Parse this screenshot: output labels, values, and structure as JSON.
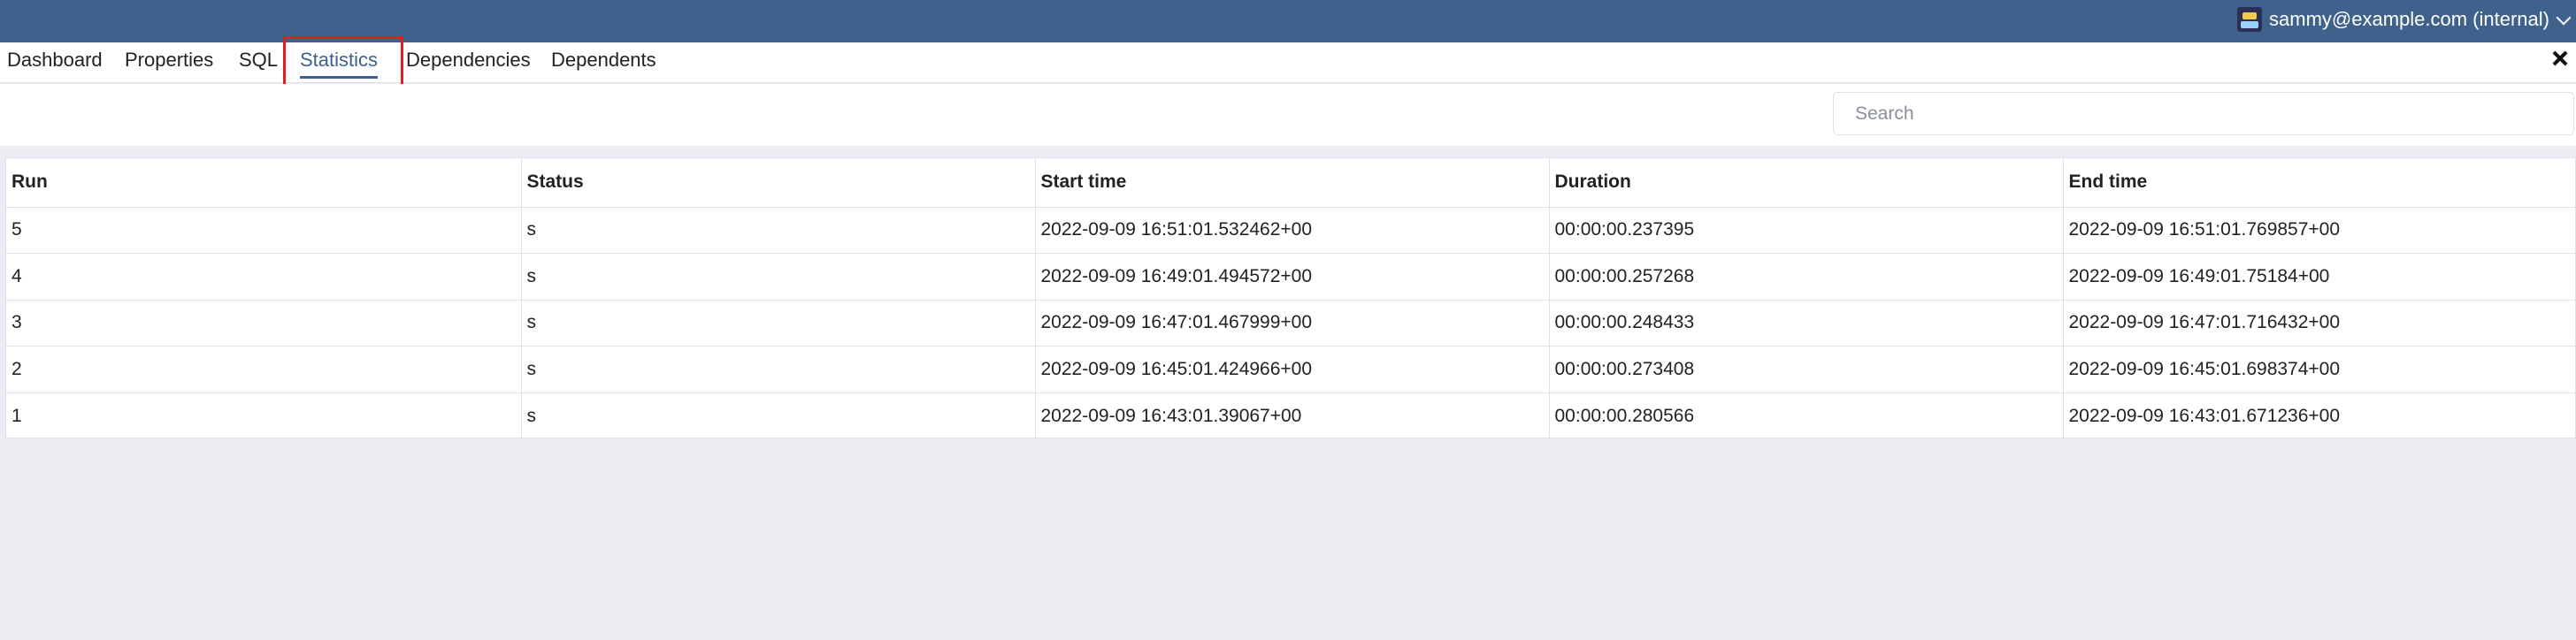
{
  "header": {
    "user_label": "sammy@example.com (internal)"
  },
  "tabs": [
    {
      "label": "Dashboard"
    },
    {
      "label": "Properties"
    },
    {
      "label": "SQL"
    },
    {
      "label": "Statistics"
    },
    {
      "label": "Dependencies"
    },
    {
      "label": "Dependents"
    }
  ],
  "search": {
    "placeholder": "Search",
    "value": ""
  },
  "table": {
    "columns": [
      "Run",
      "Status",
      "Start time",
      "Duration",
      "End time"
    ],
    "rows": [
      [
        "5",
        "s",
        "2022-09-09 16:51:01.532462+00",
        "00:00:00.237395",
        "2022-09-09 16:51:01.769857+00"
      ],
      [
        "4",
        "s",
        "2022-09-09 16:49:01.494572+00",
        "00:00:00.257268",
        "2022-09-09 16:49:01.75184+00"
      ],
      [
        "3",
        "s",
        "2022-09-09 16:47:01.467999+00",
        "00:00:00.248433",
        "2022-09-09 16:47:01.716432+00"
      ],
      [
        "2",
        "s",
        "2022-09-09 16:45:01.424966+00",
        "00:00:00.273408",
        "2022-09-09 16:45:01.698374+00"
      ],
      [
        "1",
        "s",
        "2022-09-09 16:43:01.39067+00",
        "00:00:00.280566",
        "2022-09-09 16:43:01.671236+00"
      ]
    ]
  }
}
